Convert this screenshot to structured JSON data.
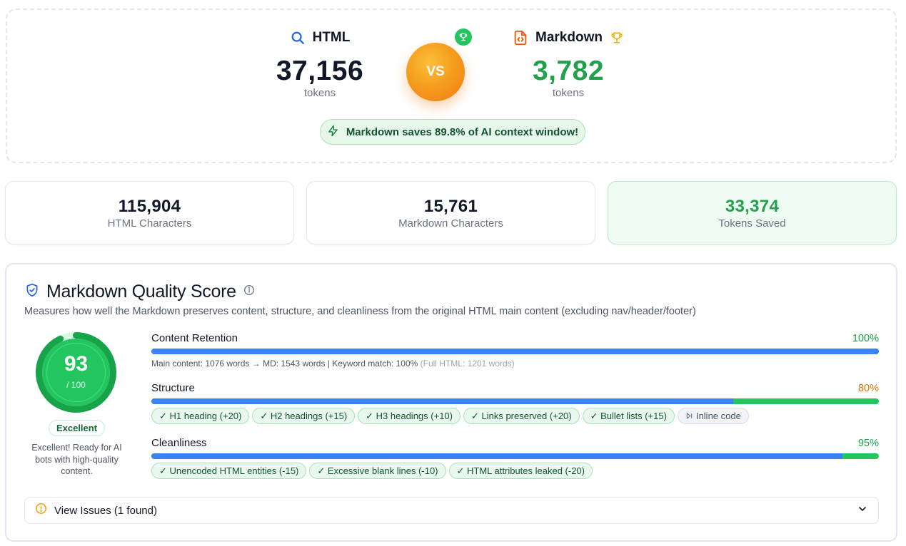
{
  "comparison": {
    "html": {
      "name": "HTML",
      "tokens": "37,156",
      "unit": "tokens"
    },
    "markdown": {
      "name": "Markdown",
      "tokens": "3,782",
      "unit": "tokens"
    },
    "vs_label": "VS",
    "savings_text": "Markdown saves 89.8% of AI context window!"
  },
  "stats": [
    {
      "value": "115,904",
      "label": "HTML Characters"
    },
    {
      "value": "15,761",
      "label": "Markdown Characters"
    },
    {
      "value": "33,374",
      "label": "Tokens Saved"
    }
  ],
  "quality": {
    "title": "Markdown Quality Score",
    "description": "Measures how well the Markdown preserves content, structure, and cleanliness from the original HTML main content (excluding nav/header/footer)",
    "score": "93",
    "score_max": "/ 100",
    "score_fraction": 0.93,
    "grade": "Excellent",
    "grade_description": "Excellent! Ready for AI bots with high-quality content.",
    "metrics": {
      "content": {
        "name": "Content Retention",
        "percent": "100%",
        "fraction": 1.0,
        "color": "#16a34a",
        "detail": "Main content: 1076 words → MD: 1543 words | Keyword match: 100%",
        "detail_muted": "(Full HTML: 1201 words)"
      },
      "structure": {
        "name": "Structure",
        "percent": "80%",
        "fraction": 0.8,
        "color": "#d97706",
        "tags": [
          "✓ H1 heading (+20)",
          "✓ H2 headings (+15)",
          "✓ H3 headings (+10)",
          "✓ Links preserved (+20)",
          "✓ Bullet lists (+15)"
        ],
        "inactive_tag": "Inline code"
      },
      "cleanliness": {
        "name": "Cleanliness",
        "percent": "95%",
        "fraction": 0.95,
        "color": "#16a34a",
        "tags": [
          "✓ Unencoded HTML entities (-15)",
          "✓ Excessive blank lines (-10)",
          "✓ HTML attributes leaked (-20)"
        ]
      }
    },
    "issues_label": "View Issues (1 found)"
  },
  "colors": {
    "accent_blue": "#3b82f6",
    "success_green": "#22c55e",
    "warning_orange": "#d97706"
  },
  "icons": {
    "html": "search-icon",
    "markdown": "code-file-icon",
    "winner": "trophy-icon",
    "savings": "lightning-icon",
    "quality": "shield-check-icon",
    "info": "info-icon",
    "issues": "alert-circle-icon",
    "expand": "chevron-down-icon"
  }
}
